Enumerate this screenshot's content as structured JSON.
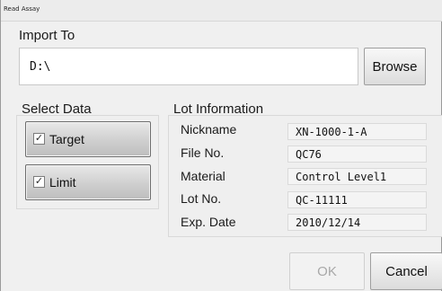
{
  "window": {
    "title": "Read Assay"
  },
  "import": {
    "label": "Import To",
    "path_value": "D:\\",
    "browse_label": "Browse"
  },
  "select_data": {
    "label": "Select Data",
    "target_label": "Target",
    "target_checked": true,
    "limit_label": "Limit",
    "limit_checked": true
  },
  "lot_information": {
    "label": "Lot Information",
    "fields": [
      {
        "label": "Nickname",
        "value": "XN-1000-1-A"
      },
      {
        "label": "File No.",
        "value": "QC76"
      },
      {
        "label": "Material",
        "value": "Control Level1"
      },
      {
        "label": "Lot No.",
        "value": "QC-11111"
      },
      {
        "label": "Exp. Date",
        "value": "2010/12/14"
      }
    ]
  },
  "actions": {
    "ok_label": "OK",
    "ok_enabled": false,
    "cancel_label": "Cancel"
  },
  "icons": {
    "checkmark": "checkbox-checked-icon"
  },
  "colors": {
    "window_bg": "#f0f0f0",
    "disabled_text": "#a8a8a8"
  }
}
